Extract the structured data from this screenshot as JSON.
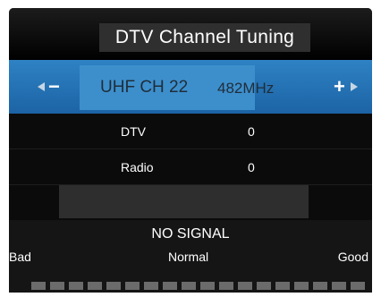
{
  "window": {
    "title": "DTV Channel Tuning"
  },
  "channel": {
    "label": "UHF CH 22",
    "frequency": "482MHz",
    "minus_symbol": "−",
    "plus_symbol": "+"
  },
  "info": {
    "dtv_label": "DTV",
    "dtv_value": "0",
    "radio_label": "Radio",
    "radio_value": "0"
  },
  "scan_progress": {
    "fraction": 0
  },
  "signal": {
    "status": "NO SIGNAL",
    "bad_label": "Bad",
    "normal_label": "Normal",
    "good_label": "Good",
    "segments_total": 18,
    "segments_active": 0
  },
  "colors": {
    "accent": "#2e82c3",
    "meter_off": "#6b6b6b",
    "meter_on": "#4a9ad6"
  }
}
